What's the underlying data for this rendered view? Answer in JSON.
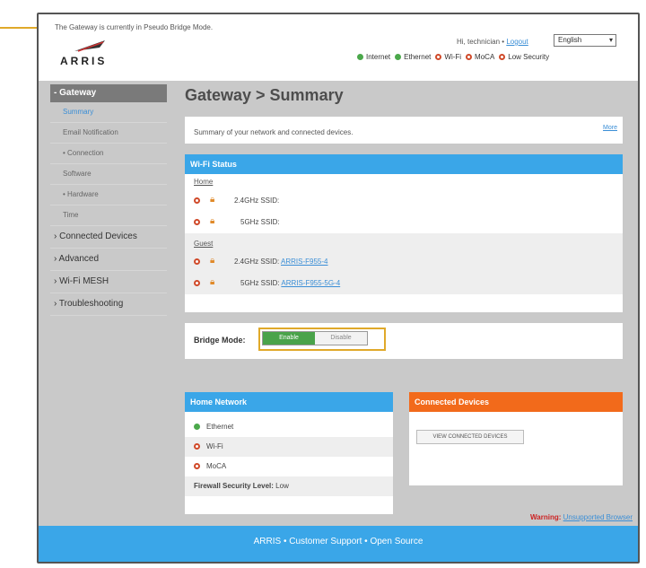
{
  "mode_message": "The Gateway is currently in Pseudo Bridge Mode.",
  "logo_text": "ARRIS",
  "user": {
    "greeting": "Hi, technician",
    "sep": "•",
    "logout": "Logout"
  },
  "language": {
    "selected": "English"
  },
  "status": [
    {
      "label": "Internet",
      "ok": true
    },
    {
      "label": "Ethernet",
      "ok": true
    },
    {
      "label": "Wi-Fi",
      "ok": false
    },
    {
      "label": "MoCA",
      "ok": false
    },
    {
      "label": "Low Security",
      "ok": false
    }
  ],
  "sidebar": {
    "header": "- Gateway",
    "sub_items": [
      "Summary",
      "Email Notification",
      "• Connection",
      "Software",
      "• Hardware",
      "Time"
    ],
    "main_items": [
      "› Connected Devices",
      "› Advanced",
      "› Wi-Fi MESH",
      "› Troubleshooting"
    ]
  },
  "page_title": "Gateway > Summary",
  "summary": {
    "text": "Summary of your network and connected devices.",
    "more": "More"
  },
  "wifi": {
    "title": "Wi-Fi Status",
    "home_label": "Home",
    "home_rows": [
      {
        "label": "2.4GHz SSID:",
        "ssid": ""
      },
      {
        "label": "5GHz SSID:",
        "ssid": ""
      }
    ],
    "guest_label": "Guest",
    "guest_rows": [
      {
        "label": "2.4GHz SSID:",
        "ssid": "ARRIS-F955-4"
      },
      {
        "label": "5GHz SSID:",
        "ssid": "ARRIS-F955-5G-4"
      }
    ]
  },
  "bridge": {
    "label": "Bridge Mode:",
    "enable": "Enable",
    "disable": "Disable"
  },
  "home_network": {
    "title": "Home Network",
    "items": [
      {
        "label": "Ethernet",
        "ok": true
      },
      {
        "label": "Wi-Fi",
        "ok": false
      },
      {
        "label": "MoCA",
        "ok": false
      }
    ],
    "firewall_label": "Firewall Security Level:",
    "firewall_value": "Low"
  },
  "connected_devices": {
    "title": "Connected Devices",
    "button": "VIEW CONNECTED DEVICES"
  },
  "warning": {
    "label": "Warning:",
    "link": "Unsupported Browser"
  },
  "footer": "ARRIS  •  Customer Support  •  Open Source"
}
